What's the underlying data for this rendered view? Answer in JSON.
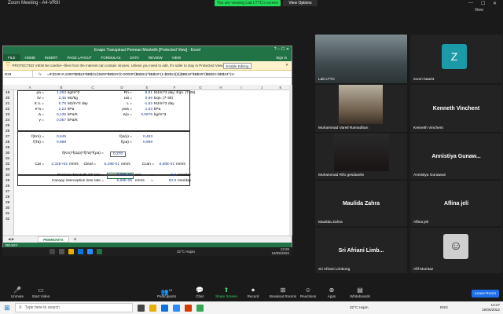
{
  "zoom": {
    "window_title": "Zoom Meeting - A4-VRIII",
    "viewing_banner": "You are viewing Lab LTTC's screen",
    "view_options": "View Options",
    "view_label": "View",
    "toolbar": [
      {
        "label": "Unmute",
        "icon": "mic-muted-icon"
      },
      {
        "label": "Start Video",
        "icon": "video-off-icon"
      },
      {
        "label": "Participants",
        "icon": "participants-icon",
        "count": "10"
      },
      {
        "label": "Chat",
        "icon": "chat-icon"
      },
      {
        "label": "Share Screen",
        "icon": "share-screen-icon"
      },
      {
        "label": "Record",
        "icon": "record-icon"
      },
      {
        "label": "Breakout Rooms",
        "icon": "breakout-icon"
      },
      {
        "label": "Reactions",
        "icon": "reactions-icon"
      },
      {
        "label": "Apps",
        "icon": "apps-icon"
      },
      {
        "label": "Whiteboards",
        "icon": "whiteboard-icon"
      }
    ],
    "leave_label": "Leave Room"
  },
  "participants": [
    {
      "name": "Lab LTTC",
      "type": "video"
    },
    {
      "name": "zoom baa04",
      "type": "avatar",
      "initial": "Z"
    },
    {
      "name": "Muhammad Vareil Ramadhan",
      "type": "video"
    },
    {
      "name": "Kenneth Vinchent",
      "type": "name",
      "display": "Kenneth Vinchent"
    },
    {
      "name": "Muhammad Rifo gesdianlie",
      "type": "video"
    },
    {
      "name": "Annistiya Gunawan",
      "type": "name",
      "display": "Annistiya  Gunaw..."
    },
    {
      "name": "Maulida Zahra",
      "type": "name",
      "display": "Maulida Zahra"
    },
    {
      "name": "Aflina jeli",
      "type": "name",
      "display": "Aflina jeli"
    },
    {
      "name": "Sri Afriani Limbong",
      "type": "name",
      "display": "Sri Afriani  Limb..."
    },
    {
      "name": "Afif Mumtaz",
      "type": "avatar-image"
    }
  ],
  "excel": {
    "title": "Evapo Transpirasi Penman Monteith  [Protected View] - Excel",
    "ribbon_tabs": [
      "FILE",
      "HOME",
      "INSERT",
      "PAGE LAYOUT",
      "FORMULAS",
      "DATA",
      "REVIEW",
      "VIEW"
    ],
    "sign_in": "Sign in",
    "protected_text": "PROTECTED VIEW  Be careful—files from the Internet can contain viruses. Unless you need to edit, it's safer to stay in Protected View.",
    "enable_editing": "Enable Editing",
    "name_box": "D33",
    "formula": "=IF(D29>0,1000*$B$23*$B$21/(3600*$B$33*(0.00000*($B$31)^$B$22*(1-$D$13))/(($B$18^$B$30^($B$23+$B$24^(1+",
    "columns": [
      "A",
      "B",
      "C",
      "D",
      "E",
      "F",
      "G",
      "H",
      "I",
      "J",
      "K"
    ],
    "rows": [
      "19",
      "20",
      "21",
      "22",
      "23",
      "24",
      "25",
      "26",
      "27",
      "28",
      "29",
      "30",
      "31",
      "32",
      "33",
      "34",
      "25",
      "26",
      "27",
      "28",
      "29",
      "30",
      "31",
      "32"
    ],
    "cells": {
      "a19": "ρa =",
      "b19": "1,263",
      "c19": "kg/m^3",
      "d19": "Rn =",
      "e19": "8,91",
      "f19": "MJ/m^2 day; Eqn. (7-26)",
      "a20": "λv =",
      "b20": "2,45",
      "c20": "MJ/kg",
      "d20": "εat =",
      "e20": "0,96",
      "f20": "Eqn. (7-30)",
      "a21": "K↓L =",
      "b21": "5,79",
      "c21": "MJ/m^2 day",
      "d21": "L =",
      "e21": "-1,52",
      "f21": "MJ/m^2 day",
      "a22": "e*a =",
      "b22": "2,23",
      "c22": "kPa",
      "d22": "ρws =",
      "e22": "1,03",
      "f22": "kPa",
      "a23": "Δ =",
      "b23": "0,139",
      "c23": "kPa/K",
      "d23": "Δ/ρ =",
      "e23": "0,0676",
      "f23": "kg/m^3",
      "a24": "γ =",
      "b24": "0,067",
      "c24": "kPa/K",
      "a26": "f(Km) =",
      "b26": "0,549",
      "d26": "f(Δ/ρ) =",
      "e26": "0,493",
      "a27": "f(Ta) =",
      "b27": "0,998",
      "d27": "f(ρa) =",
      "e27": "0,999",
      "a29": "f(Km)*f(Δ/ρ)*f(Ta)*f(ρa) =",
      "d29": "0,270",
      "a31": "Cat =",
      "b31": "2,32E+02",
      "c31": "mm/s",
      "d31": "Cleaf =",
      "d31v": "6,29E-01",
      "d31u": "mm/s",
      "e31": "Ccan =",
      "f31": "8,68E-01",
      "f31u": "mm/s",
      "a33": "Penman-Monteith ET rate =",
      "d33": "6,73E-06",
      "e33": "m/s",
      "e33b": "=",
      "f33": "0,6",
      "g33": "mm/day",
      "a34": "Canopy interception loss rate =",
      "d34": "5,89E-06",
      "e34": "mm/s",
      "e34b": "=",
      "f34": "50,9",
      "g34": "mm/day"
    },
    "sheet_tab": "PENMONTX",
    "status": "READY"
  },
  "remote_taskbar": {
    "weather": "32°C  Hujan",
    "time": "13:26",
    "date": "19/05/2022"
  },
  "windows_taskbar": {
    "search_placeholder": "Type here to search",
    "weather": "32°C  Hujan",
    "time": "13:27",
    "date": "19/05/2022",
    "lang": "ENG"
  }
}
